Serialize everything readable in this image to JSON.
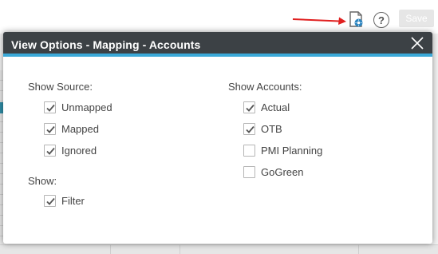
{
  "toolbar": {
    "save_label": "Save",
    "help_glyph": "?",
    "icons": {
      "page_settings": "page-settings-icon",
      "help": "help-icon"
    },
    "arrow_color": "#e02020"
  },
  "dialog": {
    "title": "View Options - Mapping - Accounts",
    "header_color": "#3c4145",
    "accent_color": "#3ba9d8",
    "close_icon": "close-icon",
    "show_source": {
      "label": "Show Source:",
      "options": [
        {
          "label": "Unmapped",
          "checked": true
        },
        {
          "label": "Mapped",
          "checked": true
        },
        {
          "label": "Ignored",
          "checked": true
        }
      ]
    },
    "show": {
      "label": "Show:",
      "options": [
        {
          "label": "Filter",
          "checked": true
        }
      ]
    },
    "show_accounts": {
      "label": "Show Accounts:",
      "options": [
        {
          "label": "Actual",
          "checked": true
        },
        {
          "label": "OTB",
          "checked": true
        },
        {
          "label": "PMI Planning",
          "checked": false
        },
        {
          "label": "GoGreen",
          "checked": false
        }
      ]
    }
  }
}
